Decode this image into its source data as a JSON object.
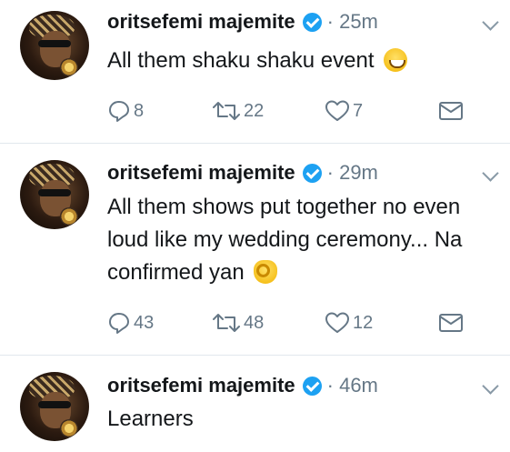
{
  "tweets": [
    {
      "author": "oritsefemi majemite",
      "time": "· 25m",
      "text": "All them shaku shaku event",
      "emoji": "grinning-face",
      "replies": "8",
      "retweets": "22",
      "likes": "7"
    },
    {
      "author": "oritsefemi majemite",
      "time": "· 29m",
      "text": "All them shows put together no even loud like my wedding ceremony... Na confirmed yan",
      "emoji": "ok-hand",
      "replies": "43",
      "retweets": "48",
      "likes": "12"
    },
    {
      "author": "oritsefemi majemite",
      "time": "· 46m",
      "text": "Learners",
      "emoji": "",
      "replies": "",
      "retweets": "",
      "likes": ""
    }
  ],
  "colors": {
    "verified": "#1da1f2",
    "meta_text": "#657786",
    "divider": "#e1e8ed"
  }
}
